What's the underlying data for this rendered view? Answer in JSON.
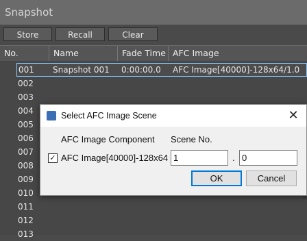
{
  "panel": {
    "title": "Snapshot"
  },
  "toolbar": {
    "store_label": "Store",
    "recall_label": "Recall",
    "clear_label": "Clear"
  },
  "columns": {
    "no": "No.",
    "name": "Name",
    "fade": "Fade Time",
    "afc": "AFC Image"
  },
  "rows": [
    {
      "no": "001",
      "name": "Snapshot 001",
      "fade": "0:00:00.0",
      "afc": "AFC Image[40000]-128x64/1.0"
    },
    {
      "no": "002",
      "name": "",
      "fade": "",
      "afc": ""
    },
    {
      "no": "003",
      "name": "",
      "fade": "",
      "afc": ""
    },
    {
      "no": "004",
      "name": "",
      "fade": "",
      "afc": ""
    },
    {
      "no": "005",
      "name": "",
      "fade": "",
      "afc": ""
    },
    {
      "no": "006",
      "name": "",
      "fade": "",
      "afc": ""
    },
    {
      "no": "007",
      "name": "",
      "fade": "",
      "afc": ""
    },
    {
      "no": "008",
      "name": "",
      "fade": "",
      "afc": ""
    },
    {
      "no": "009",
      "name": "",
      "fade": "",
      "afc": ""
    },
    {
      "no": "010",
      "name": "",
      "fade": "",
      "afc": ""
    },
    {
      "no": "011",
      "name": "",
      "fade": "",
      "afc": ""
    },
    {
      "no": "012",
      "name": "",
      "fade": "",
      "afc": ""
    },
    {
      "no": "013",
      "name": "",
      "fade": "",
      "afc": ""
    }
  ],
  "dialog": {
    "title": "Select AFC Image Scene",
    "close_glyph": "✕",
    "col_component": "AFC Image Component",
    "col_scene": "Scene No.",
    "component_label": "AFC Image[40000]-128x64",
    "checked": true,
    "check_glyph": "✓",
    "scene_major": "1",
    "separator": ".",
    "scene_minor": "0",
    "ok_label": "OK",
    "cancel_label": "Cancel"
  }
}
